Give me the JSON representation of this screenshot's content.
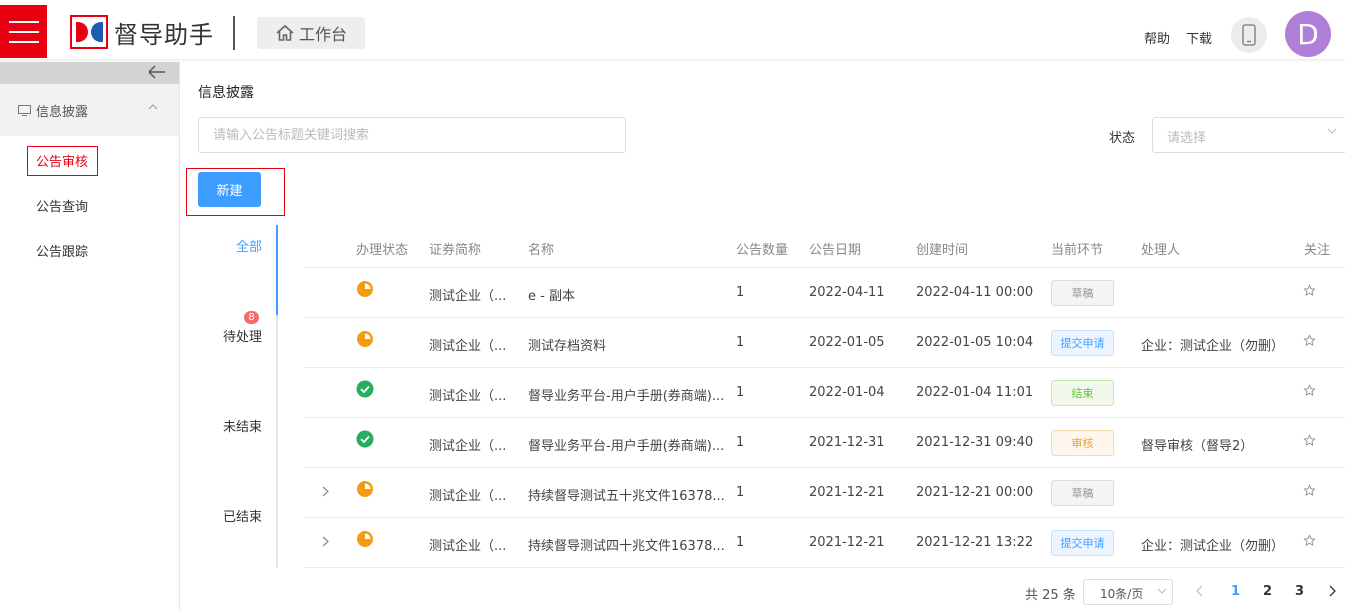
{
  "header": {
    "logo_text": "督导助手",
    "workbench_label": "工作台",
    "help_label": "帮助",
    "download_label": "下载",
    "avatar_letter": "D"
  },
  "sidebar": {
    "group_label": "信息披露",
    "items": [
      {
        "label": "公告审核"
      },
      {
        "label": "公告查询"
      },
      {
        "label": "公告跟踪"
      }
    ]
  },
  "main": {
    "title": "信息披露",
    "search_placeholder": "请输入公告标题关键词搜索",
    "status_label": "状态",
    "status_placeholder": "请选择",
    "new_button": "新建"
  },
  "tabs": [
    {
      "label": "全部"
    },
    {
      "label": "待处理",
      "badge": "8"
    },
    {
      "label": "未结束"
    },
    {
      "label": "已结束"
    }
  ],
  "table": {
    "headers": [
      "办理状态",
      "证券简称",
      "名称",
      "公告数量",
      "公告日期",
      "创建时间",
      "当前环节",
      "处理人",
      "关注"
    ],
    "rows": [
      {
        "status": "pending",
        "security": "测试企业（...",
        "name": "e - 副本",
        "count": "1",
        "date": "2022-04-11",
        "created": "2022-04-11 00:00",
        "stage": "草稿",
        "stage_color": "gray",
        "handler": "",
        "expandable": false
      },
      {
        "status": "pending",
        "security": "测试企业（...",
        "name": "测试存档资料",
        "count": "1",
        "date": "2022-01-05",
        "created": "2022-01-05 10:04",
        "stage": "提交申请",
        "stage_color": "blue",
        "handler": "企业：测试企业（勿删）",
        "expandable": false
      },
      {
        "status": "done",
        "security": "测试企业（...",
        "name": "督导业务平台-用户手册(券商端)...",
        "count": "1",
        "date": "2022-01-04",
        "created": "2022-01-04 11:01",
        "stage": "结束",
        "stage_color": "green",
        "handler": "",
        "expandable": false
      },
      {
        "status": "done",
        "security": "测试企业（...",
        "name": "督导业务平台-用户手册(券商端)...",
        "count": "1",
        "date": "2021-12-31",
        "created": "2021-12-31 09:40",
        "stage": "审核",
        "stage_color": "orange",
        "handler": "督导审核（督导2）",
        "expandable": false
      },
      {
        "status": "pending",
        "security": "测试企业（...",
        "name": "持续督导测试五十兆文件16378...",
        "count": "1",
        "date": "2021-12-21",
        "created": "2021-12-21 00:00",
        "stage": "草稿",
        "stage_color": "gray",
        "handler": "",
        "expandable": true
      },
      {
        "status": "pending",
        "security": "测试企业（...",
        "name": "持续督导测试四十兆文件16378...",
        "count": "1",
        "date": "2021-12-21",
        "created": "2021-12-21 13:22",
        "stage": "提交申请",
        "stage_color": "blue",
        "handler": "企业：测试企业（勿删）",
        "expandable": true
      }
    ]
  },
  "pagination": {
    "total_label": "共 25 条",
    "page_size": "10条/页",
    "pages": [
      "1",
      "2",
      "3"
    ],
    "current": "1"
  },
  "colors": {
    "brand_red": "#e60012",
    "primary_blue": "#3d9eff",
    "pending_orange": "#f39c12",
    "done_green": "#2ecc71",
    "avatar_purple": "#b07fd8"
  }
}
